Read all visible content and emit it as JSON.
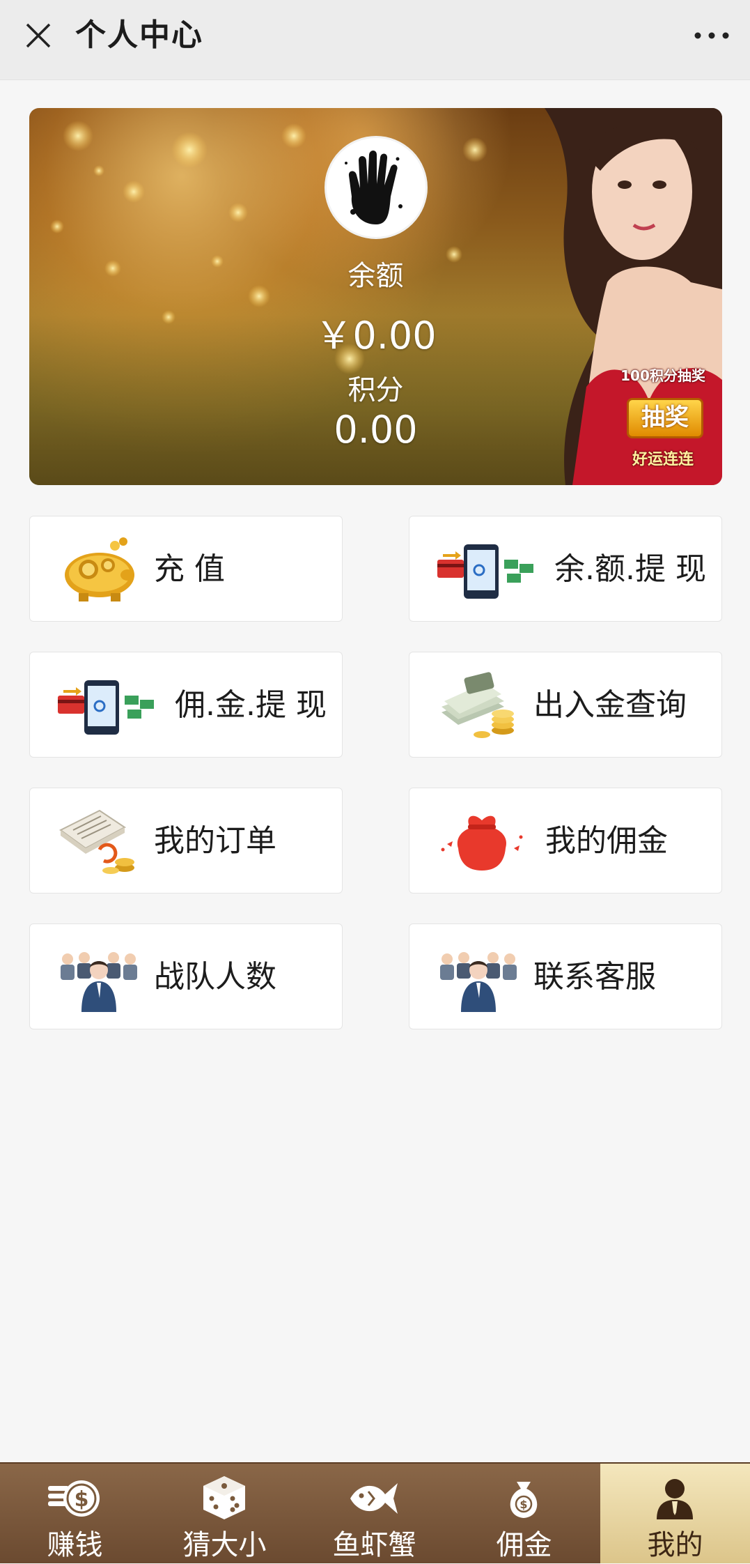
{
  "header": {
    "title": "个人中心"
  },
  "banner": {
    "balance_label": "余额",
    "balance_value": "￥0.00",
    "points_label": "积分",
    "points_value": "0.00",
    "promo": {
      "top": "100积分抽奖",
      "main": "抽奖",
      "bottom": "好运连连"
    }
  },
  "menu": [
    {
      "label": "充 值",
      "icon": "piggy-bank-icon"
    },
    {
      "label": "余.额.提 现",
      "icon": "phone-transfer-icon"
    },
    {
      "label": "佣.金.提 现",
      "icon": "phone-transfer-icon"
    },
    {
      "label": "出入金查询",
      "icon": "money-stack-icon"
    },
    {
      "label": "我的订单",
      "icon": "order-document-icon"
    },
    {
      "label": "我的佣金",
      "icon": "money-bag-icon"
    },
    {
      "label": "战队人数",
      "icon": "team-icon"
    },
    {
      "label": "联系客服",
      "icon": "team-icon"
    }
  ],
  "tabs": [
    {
      "label": "赚钱",
      "icon": "coin-icon"
    },
    {
      "label": "猜大小",
      "icon": "dice-icon"
    },
    {
      "label": "鱼虾蟹",
      "icon": "fish-icon"
    },
    {
      "label": "佣金",
      "icon": "money-bag-icon"
    },
    {
      "label": "我的",
      "icon": "user-icon",
      "active": true
    }
  ],
  "colors": {
    "tabbar": "#7a5a3c",
    "tab_active": "#e8d7a4",
    "card_bg": "#ffffff",
    "page_bg": "#f6f6f6"
  }
}
